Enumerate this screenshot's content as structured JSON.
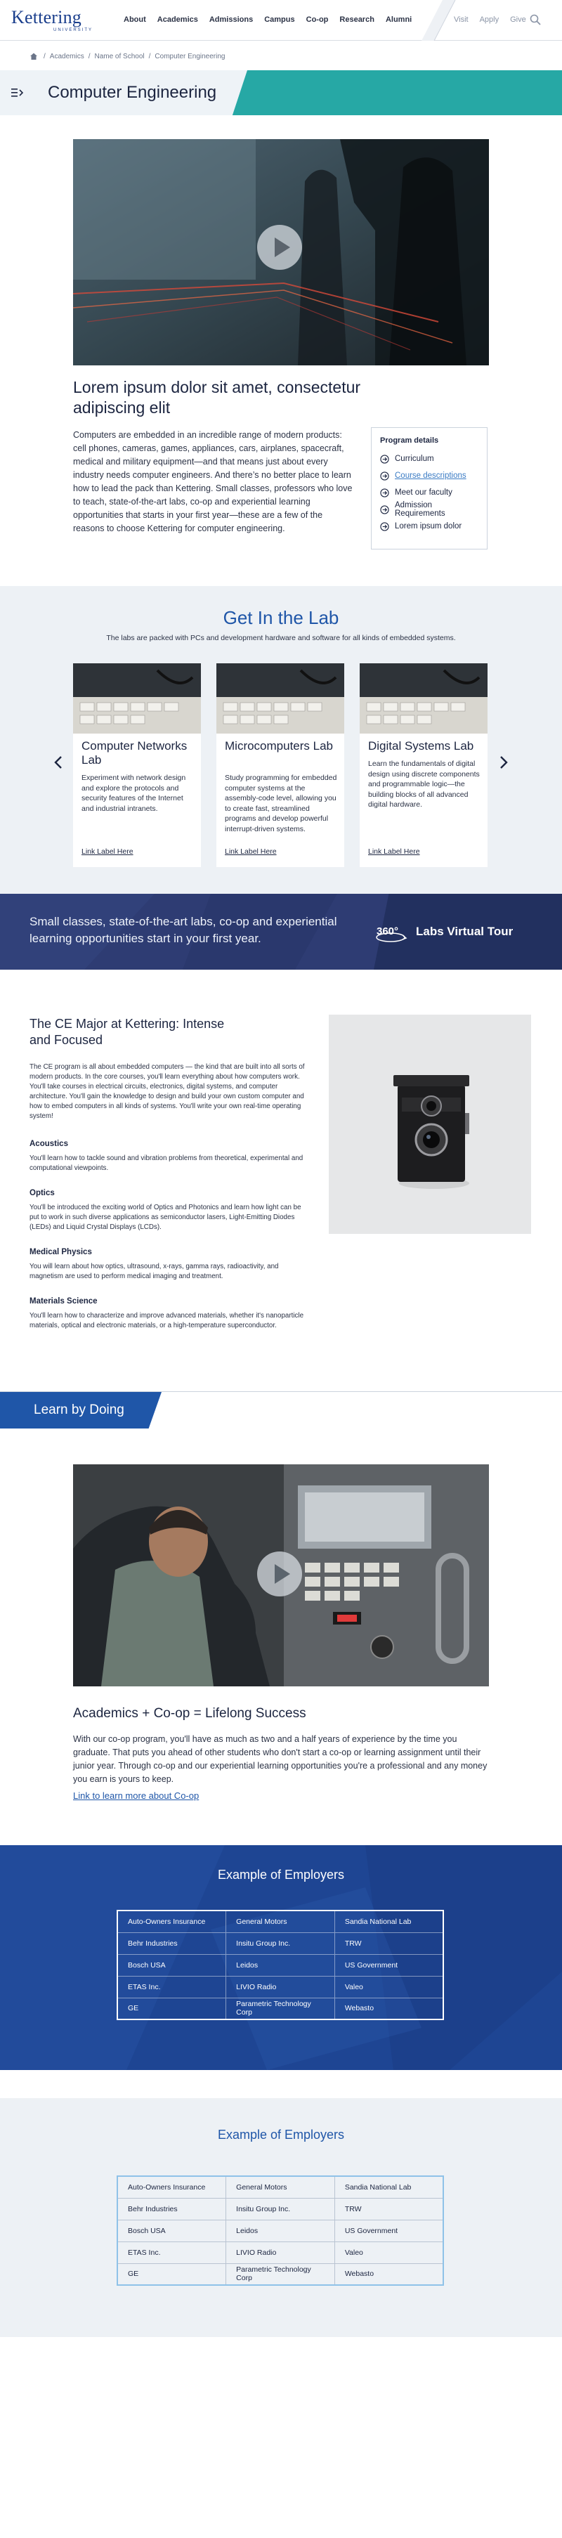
{
  "header": {
    "logo_text": "Kettering",
    "logo_subtext": "UNIVERSITY",
    "nav": [
      "About",
      "Academics",
      "Admissions",
      "Campus",
      "Co-op",
      "Research",
      "Alumni"
    ],
    "utility": [
      "Visit",
      "Apply",
      "Give"
    ],
    "search_icon": "search-icon"
  },
  "breadcrumb": [
    "Academics",
    "/",
    "Name of School",
    "/",
    "Computer Engineering"
  ],
  "page_title": "Computer Engineering",
  "colors": {
    "brand_blue": "#1f56a8",
    "teal": "#26a8a5",
    "navy": "#2e3c73",
    "link": "#3a7bc4"
  },
  "intro": {
    "heading": "Lorem ipsum dolor sit amet, consectetur adipiscing elit",
    "body": "Computers are embedded in an incredible range of modern products: cell phones, cameras, games, appliances, cars, airplanes, spacecraft, medical and military equipment—and that means just about every industry needs computer engineers. And there’s no better place to learn how to lead the pack than Kettering. Small classes, professors who love to teach, state-of-the-art labs, co-op and experiential learning opportunities that starts in your first year—these are a few of the reasons to choose Kettering for computer engineering."
  },
  "program_details": {
    "title": "Program details",
    "items": [
      "Curriculum",
      "Course descriptions",
      "Meet our faculty",
      "Admission Requirements",
      "Lorem ipsum dolor"
    ]
  },
  "labs": {
    "title": "Get In the Lab",
    "subtitle": "The labs are packed with PCs and development hardware and software for all kinds of embedded systems.",
    "cards": [
      {
        "title": "Computer Networks Lab",
        "body": "Experiment with network design and explore the protocols and security features of the Internet and industrial intranets.",
        "link": "Link Label Here"
      },
      {
        "title": "Microcomputers Lab",
        "body": "Study programming for embedded computer systems at the assembly-code level, allowing you to create fast, streamlined programs and develop powerful interrupt-driven systems.",
        "link": "Link Label Here"
      },
      {
        "title": "Digital Systems Lab",
        "body": "Learn the fundamentals of digital design using discrete components and programmable logic—the building blocks of all advanced digital hardware.",
        "link": "Link Label Here"
      }
    ]
  },
  "banner": {
    "text": "Small classes, state-of-the-art labs, co-op and experiential learning opportunities start in your first year.",
    "tour_badge": "360°",
    "tour_label": "Labs Virtual Tour"
  },
  "major": {
    "heading": "The CE Major at Kettering: Intense and Focused",
    "body": "The CE program is all about embedded computers — the kind that are built into all sorts of modern products. In the core courses, you'll learn everything about how computers work. You'll take courses in electrical circuits, electronics, digital systems, and computer architecture. You'll gain the knowledge to design and build your own custom computer and how to embed computers in all kinds of systems. You'll write your own real-time operating system!",
    "sections": [
      {
        "title": "Acoustics",
        "body": "You'll learn how to tackle sound and vibration problems from theoretical, experimental and computational viewpoints."
      },
      {
        "title": "Optics",
        "body": "You'll be introduced the exciting world of Optics and Photonics and learn how light can be put to work in such diverse applications as semiconductor lasers, Light-Emitting Diodes (LEDs) and Liquid Crystal Displays (LCDs)."
      },
      {
        "title": "Medical Physics",
        "body": "You will learn about how optics, ultrasound, x-rays, gamma rays, radioactivity, and magnetism are used to perform medical imaging and treatment."
      },
      {
        "title": "Materials Science",
        "body": "You'll learn how to characterize and improve advanced materials, whether it's nanoparticle materials, optical and electronic materials, or a high-temperature superconductor."
      }
    ]
  },
  "learn_by_doing": {
    "tag": "Learn by Doing",
    "heading": "Academics + Co-op = Lifelong Success",
    "body": "With our co-op program, you'll have as much as two and a half years of experience by the time you graduate. That puts you ahead of other students who don't start a co-op or learning assignment until their junior year. Through co-op and our experiential learning opportunities you're a professional and any money you earn is yours to keep.",
    "link": "Link to learn more about Co-op"
  },
  "employers": {
    "title": "Example of Employers",
    "rows": [
      [
        "Auto-Owners Insurance",
        "General Motors",
        "Sandia National Lab"
      ],
      [
        "Behr Industries",
        "Insitu Group Inc.",
        "TRW"
      ],
      [
        "Bosch USA",
        "Leidos",
        "US Government"
      ],
      [
        "ETAS Inc.",
        "LIVIO Radio",
        "Valeo"
      ],
      [
        "GE",
        "Parametric Technology Corp",
        "Webasto"
      ]
    ]
  }
}
